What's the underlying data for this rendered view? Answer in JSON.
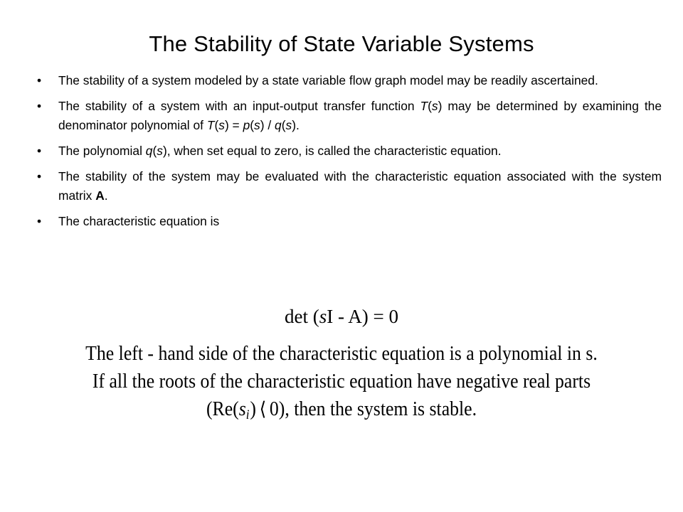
{
  "slide": {
    "title": "The Stability of State Variable Systems",
    "background_color": "#ffffff",
    "text_color": "#000000",
    "bullet_marker": "•"
  },
  "bullets": [
    {
      "id": "bullet-flow-graph",
      "segments": [
        {
          "text": "The stability of a system modeled by a state variable flow graph model may be readily ascertained.",
          "style": "normal"
        }
      ]
    },
    {
      "id": "bullet-transfer-function",
      "segments": [
        {
          "text": "The stability of a system with an input-output transfer function ",
          "style": "normal"
        },
        {
          "text": "T",
          "style": "italic"
        },
        {
          "text": "(",
          "style": "normal"
        },
        {
          "text": "s",
          "style": "italic"
        },
        {
          "text": ") may be determined by examining the denominator polynomial of ",
          "style": "normal"
        },
        {
          "text": "T",
          "style": "italic"
        },
        {
          "text": "(",
          "style": "normal"
        },
        {
          "text": "s",
          "style": "italic"
        },
        {
          "text": ") = ",
          "style": "normal"
        },
        {
          "text": "p",
          "style": "italic"
        },
        {
          "text": "(",
          "style": "normal"
        },
        {
          "text": "s",
          "style": "italic"
        },
        {
          "text": ") / ",
          "style": "normal"
        },
        {
          "text": "q",
          "style": "italic"
        },
        {
          "text": "(",
          "style": "normal"
        },
        {
          "text": "s",
          "style": "italic"
        },
        {
          "text": ").",
          "style": "normal"
        }
      ]
    },
    {
      "id": "bullet-characteristic-equation",
      "segments": [
        {
          "text": "The polynomial ",
          "style": "normal"
        },
        {
          "text": "q",
          "style": "italic"
        },
        {
          "text": "(",
          "style": "normal"
        },
        {
          "text": "s",
          "style": "italic"
        },
        {
          "text": "), when set equal to zero, is called the characteristic equation.",
          "style": "normal"
        }
      ]
    },
    {
      "id": "bullet-system-matrix",
      "segments": [
        {
          "text": "The stability of the system may be evaluated with the characteristic equation associated with the system matrix ",
          "style": "normal"
        },
        {
          "text": "A",
          "style": "bold"
        },
        {
          "text": ".",
          "style": "normal"
        }
      ]
    },
    {
      "id": "bullet-equation-intro",
      "short": true,
      "segments": [
        {
          "text": "The characteristic equation is",
          "style": "normal"
        }
      ]
    }
  ],
  "equation": {
    "id": "characteristic-equation",
    "plain": "det (sI - A) = 0",
    "segments": [
      {
        "text": "det (",
        "style": "normal"
      },
      {
        "text": "s",
        "style": "italic"
      },
      {
        "text": "I - A) = 0",
        "style": "normal"
      }
    ]
  },
  "statements": [
    {
      "id": "statement-polynomial",
      "plain": "The left - hand side of the characteristic equation is a polynomial in s.",
      "segments": [
        {
          "text": "The left - hand side of the characteristic equation is a polynomial in s.",
          "style": "normal"
        }
      ]
    },
    {
      "id": "statement-roots",
      "plain": "If all the roots of the characteristic equation have negative real parts",
      "segments": [
        {
          "text": "If all the roots of the characteristic equation have negative real parts",
          "style": "normal"
        }
      ]
    },
    {
      "id": "statement-stable",
      "plain": "(Re(s_i) ⟨ 0), then the system is stable.",
      "segments": [
        {
          "text": "(Re(",
          "style": "normal"
        },
        {
          "text": "s",
          "style": "italic"
        },
        {
          "text": "i",
          "style": "subscript"
        },
        {
          "text": ")",
          "style": "normal"
        },
        {
          "text": "⟨",
          "style": "angle"
        },
        {
          "text": "0), then the system is stable.",
          "style": "normal"
        }
      ]
    }
  ]
}
